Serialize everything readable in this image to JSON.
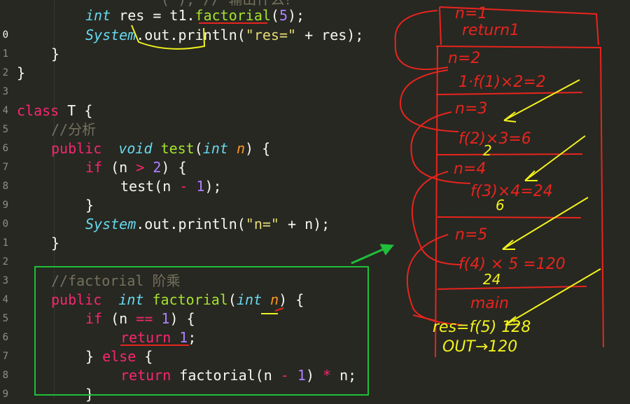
{
  "gutter": {
    "line_numbers": [
      "",
      "0",
      "1",
      "2",
      "3",
      "4",
      "5",
      "6",
      "7",
      "8",
      "9",
      "0",
      "1",
      "2",
      "3",
      "4",
      "5",
      "6",
      "7",
      "8",
      "9"
    ]
  },
  "code": {
    "top_partial_comment": "( ); // 输出什么？",
    "l1": [
      "int",
      " res = t1.",
      "factorial",
      "(",
      "5",
      ");"
    ],
    "l2": [
      "System",
      ".out.println(",
      "\"res=\"",
      " + res);"
    ],
    "l3": [
      "}"
    ],
    "l4": [
      "}"
    ],
    "l6": [
      "class",
      " T {"
    ],
    "l7": [
      "//分析"
    ],
    "l8": [
      "public",
      "  ",
      "void",
      " ",
      "test",
      "(",
      "int",
      " ",
      "n",
      ") {"
    ],
    "l9": [
      "if",
      " (n ",
      ">",
      " ",
      "2",
      ") {"
    ],
    "l10": [
      "test(n ",
      "-",
      " ",
      "1",
      ");"
    ],
    "l11": [
      "}"
    ],
    "l12": [
      "System",
      ".out.println(",
      "\"n=\"",
      " + n);"
    ],
    "l13": [
      "}"
    ],
    "l15": [
      "//factorial 阶乘"
    ],
    "l16": [
      "public",
      "  ",
      "int",
      " ",
      "factorial",
      "(",
      "int",
      " ",
      "n",
      ") {"
    ],
    "l17": [
      "if",
      " (n ",
      "==",
      " ",
      "1",
      ") {"
    ],
    "l18": [
      "return",
      " ",
      "1",
      ";"
    ],
    "l19": [
      "} ",
      "else",
      " {"
    ],
    "l20": [
      "return",
      " factorial(n ",
      "-",
      " ",
      "1",
      ") ",
      "*",
      " n;"
    ],
    "l21": [
      "}"
    ]
  },
  "annotations": {
    "frame_top": [
      "n=1",
      "return1"
    ],
    "frame2": [
      "n=2",
      "1·f(1)×2=2"
    ],
    "frame3": [
      "n=3",
      "f(2)×3=6",
      "2"
    ],
    "frame4": [
      "n=4",
      "f(3)×4=24",
      "6"
    ],
    "frame5": [
      "n=5",
      "f(4) × 5 =120",
      "24"
    ],
    "main_frame": [
      "main",
      "res=f(5) 128",
      "OUT→120"
    ]
  },
  "colors": {
    "background": "#272822",
    "keyword": "#f92672",
    "type": "#66d9ef",
    "function": "#a6e22e",
    "number": "#ae81ff",
    "string": "#e6db74",
    "comment": "#75715e",
    "param": "#fd971f",
    "ink_red": "#e8241e",
    "ink_yellow": "#f2f21c",
    "ink_green": "#1fbf3a"
  }
}
